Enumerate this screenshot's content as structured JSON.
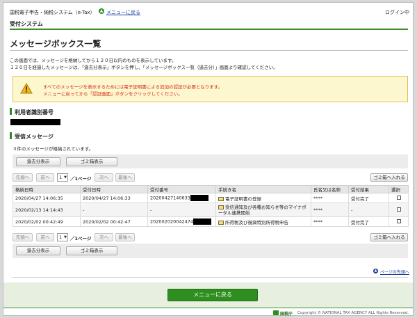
{
  "header": {
    "system_name": "国税電子申告・納税システム（e-Tax）",
    "menu_link": "メニューに戻る",
    "login_label": "ログイン中",
    "subsystem": "受付システム"
  },
  "page": {
    "title": "メッセージボックス一覧",
    "intro_line1": "この画面では、メッセージを格納してから１２０日以内のものを表示しています。",
    "intro_line2": "１２０日を経過したメッセージは、「過去分表示」ボタンを押し、「メッセージボックス一覧（過去分）」画面より確認してください。"
  },
  "notice": {
    "line1": "すべてのメッセージを表示するためには電子証明書による追加の認証が必要となります。",
    "line2": "メニューに戻ってから「認証画面」ボタンをクリックしてください。"
  },
  "user_section": {
    "heading": "利用者識別番号"
  },
  "inbox_section": {
    "heading": "受信メッセージ",
    "count_text": "３件のメッセージが格納されています。"
  },
  "toolbar": {
    "past_button": "過去分表示",
    "trash_view_button": "ゴミ箱表示",
    "first_button": "先頭へ",
    "prev_button": "前へ",
    "page_value": "1",
    "page_total": "／1ページ",
    "next_button": "次へ",
    "last_button": "最後へ",
    "move_to_trash_button": "ゴミ箱へ入れる"
  },
  "table": {
    "columns": [
      "格納日時",
      "受付日時",
      "受付番号",
      "手続き名",
      "氏名又は名称",
      "受付結果",
      "選択"
    ],
    "rows": [
      {
        "stored": "2020/04/27 14:06:35",
        "received": "2020/04/27 14:06:33",
        "number": "202004271406332",
        "procedure": "電子証明書の登録",
        "name": "****",
        "result": "受付完了"
      },
      {
        "stored": "2020/02/13 14:14:43",
        "received": "-",
        "number": "-",
        "procedure": "受信通知及び各種お知らせ等のマイナポータル連携開始",
        "name": "****",
        "result": "-"
      },
      {
        "stored": "2020/02/02 00:42:49",
        "received": "2020/02/02 00:42:47",
        "number": "202002020042474",
        "procedure": "所得税及び復興特別所得税申告",
        "name": "****",
        "result": "受付完了"
      }
    ]
  },
  "footer": {
    "page_top_link": "ページの先頭へ",
    "menu_button": "メニューに戻る",
    "agency_logo": "国税庁",
    "copyright": "Copyright © NATIONAL TAX AGENCY ALL Rights Reserved."
  },
  "colors": {
    "accent_green": "#3f8f2a",
    "menu_button_green": "#2e8f1f",
    "notice_bg": "#fdf7cf",
    "notice_text": "#d22a16",
    "link_blue": "#1a3f9a"
  }
}
